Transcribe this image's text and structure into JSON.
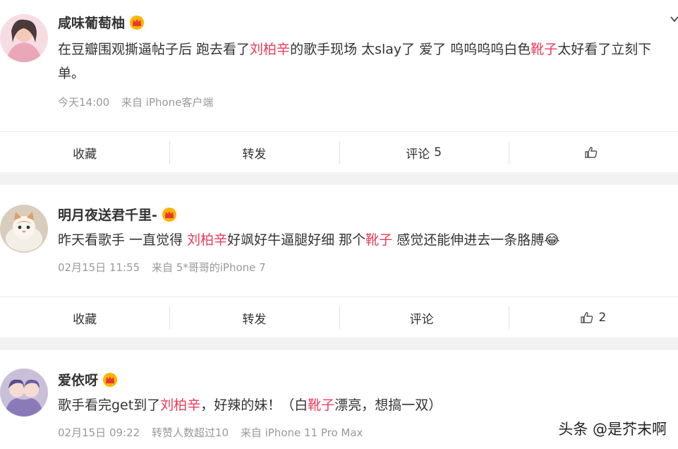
{
  "posts": [
    {
      "username": "咸味葡萄柚",
      "content_parts": [
        {
          "t": "在豆瓣围观撕逼帖子后 跑去看了",
          "h": false
        },
        {
          "t": "刘柏辛",
          "h": true
        },
        {
          "t": "的歌手现场 太slay了 爱了 呜呜呜呜白色",
          "h": false
        },
        {
          "t": "靴子",
          "h": true
        },
        {
          "t": "太好看了立刻下单。",
          "h": false
        }
      ],
      "meta": [
        "今天14:00",
        "来自 iPhone客户端"
      ],
      "actions": {
        "collect": "收藏",
        "repost": "转发",
        "comment": "评论",
        "comment_count": "5",
        "like_count": ""
      }
    },
    {
      "username": "明月夜送君千里-",
      "content_parts": [
        {
          "t": "昨天看歌手 一直觉得 ",
          "h": false
        },
        {
          "t": "刘柏辛",
          "h": true
        },
        {
          "t": "好飒好牛逼腿好细 那个",
          "h": false
        },
        {
          "t": "靴子",
          "h": true
        },
        {
          "t": " 感觉还能伸进去一条胳膊😂",
          "h": false
        }
      ],
      "meta": [
        "02月15日 11:55",
        "来自 5*哥哥的iPhone 7"
      ],
      "actions": {
        "collect": "收藏",
        "repost": "转发",
        "comment": "评论",
        "comment_count": "",
        "like_count": "2"
      }
    },
    {
      "username": "爱依呀",
      "content_parts": [
        {
          "t": "歌手看完get到了",
          "h": false
        },
        {
          "t": "刘柏辛",
          "h": true
        },
        {
          "t": "，好辣的妹！（白",
          "h": false
        },
        {
          "t": "靴子",
          "h": true
        },
        {
          "t": "漂亮，想搞一双）",
          "h": false
        }
      ],
      "meta": [
        "02月15日 09:22",
        "转赞人数超过10",
        "来自 iPhone 11 Pro Max"
      ]
    }
  ],
  "watermark": "头条 @是芥末啊",
  "icons": {
    "crown": "crown-icon",
    "like": "thumbs-up-icon",
    "more": "chevron-down-icon"
  },
  "colors": {
    "highlight": "#eb3b5a",
    "meta": "#999999",
    "background": "#f2f2f2"
  }
}
